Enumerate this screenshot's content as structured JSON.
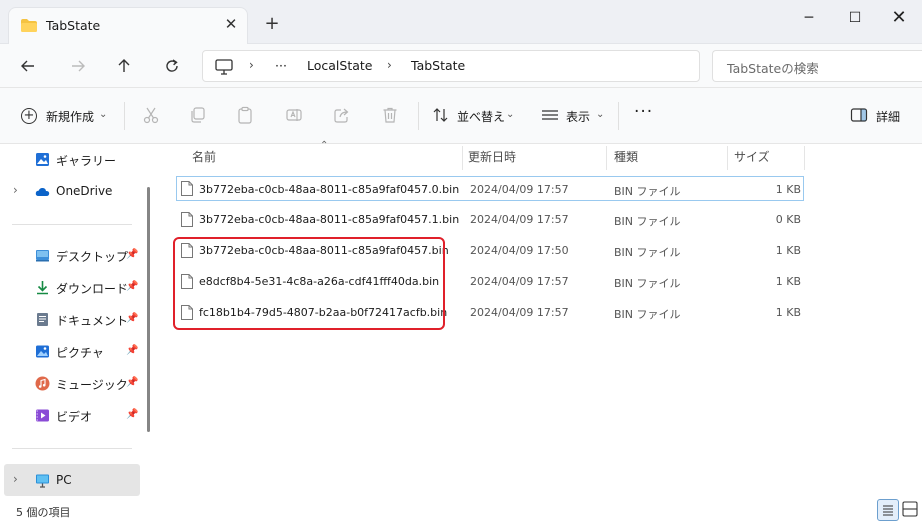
{
  "window": {
    "tab_title": "TabState",
    "new_tab": "+",
    "minimize": "─",
    "maximize": "☐",
    "close": "✕",
    "tab_close": "✕"
  },
  "address": {
    "ellipsis": "···",
    "crumbs": [
      "LocalState",
      "TabState"
    ],
    "separator": "›",
    "search_placeholder": "TabStateの検索"
  },
  "commands": {
    "new": "新規作成",
    "sort": "並べ替え",
    "view": "表示",
    "more": "···",
    "details": "詳細"
  },
  "sidebar": {
    "items": [
      {
        "label": "ギャラリー",
        "icon": "gallery-icon",
        "pinned": false
      },
      {
        "label": "OneDrive",
        "icon": "cloud-icon",
        "pinned": false,
        "expandable": true
      },
      {
        "label": "デスクトップ",
        "icon": "desktop-icon",
        "pinned": true
      },
      {
        "label": "ダウンロード",
        "icon": "download-icon",
        "pinned": true
      },
      {
        "label": "ドキュメント",
        "icon": "document-icon",
        "pinned": true
      },
      {
        "label": "ピクチャ",
        "icon": "picture-icon",
        "pinned": true
      },
      {
        "label": "ミュージック",
        "icon": "music-icon",
        "pinned": true
      },
      {
        "label": "ビデオ",
        "icon": "video-icon",
        "pinned": true
      },
      {
        "label": "PC",
        "icon": "pc-icon",
        "pinned": false,
        "expandable": true,
        "selected": true
      }
    ]
  },
  "columns": {
    "name": "名前",
    "modified": "更新日時",
    "type": "種類",
    "size": "サイズ"
  },
  "files": [
    {
      "name": "3b772eba-c0cb-48aa-8011-c85a9faf0457.0.bin",
      "modified": "2024/04/09 17:57",
      "type": "BIN ファイル",
      "size": "1 KB"
    },
    {
      "name": "3b772eba-c0cb-48aa-8011-c85a9faf0457.1.bin",
      "modified": "2024/04/09 17:57",
      "type": "BIN ファイル",
      "size": "0 KB"
    },
    {
      "name": "3b772eba-c0cb-48aa-8011-c85a9faf0457.bin",
      "modified": "2024/04/09 17:50",
      "type": "BIN ファイル",
      "size": "1 KB"
    },
    {
      "name": "e8dcf8b4-5e31-4c8a-a26a-cdf41fff40da.bin",
      "modified": "2024/04/09 17:57",
      "type": "BIN ファイル",
      "size": "1 KB"
    },
    {
      "name": "fc18b1b4-79d5-4807-b2aa-b0f72417acfb.bin",
      "modified": "2024/04/09 17:57",
      "type": "BIN ファイル",
      "size": "1 KB"
    }
  ],
  "status": {
    "item_count": "5 個の項目"
  },
  "colors": {
    "accent": "#0067c0",
    "highlight_box": "#e0202a",
    "folder": "#f5c342"
  }
}
